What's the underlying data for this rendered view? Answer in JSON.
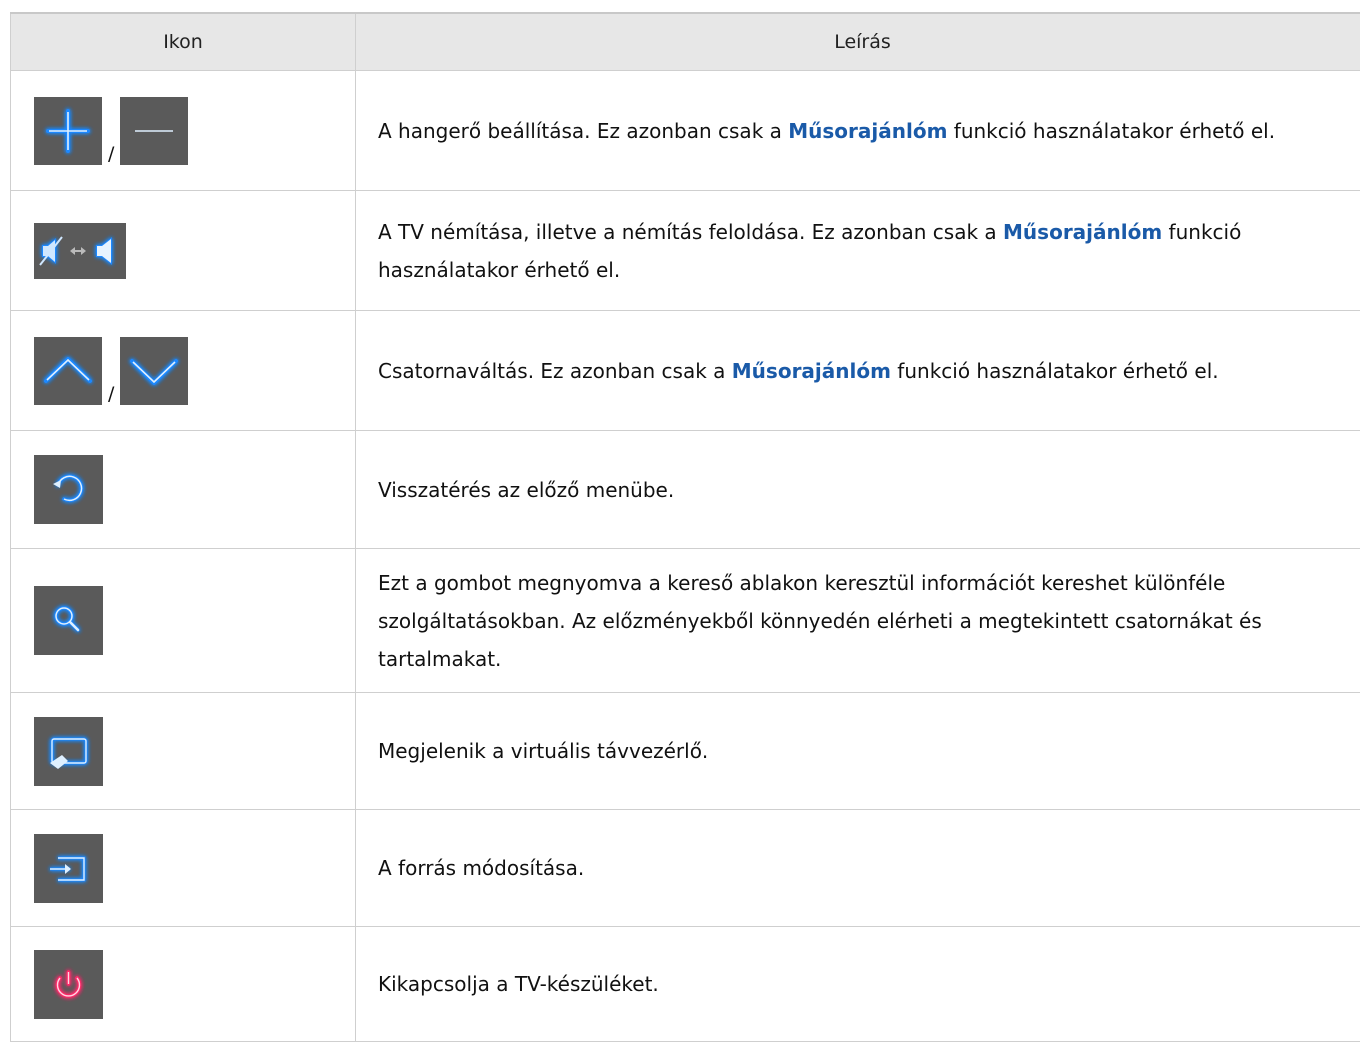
{
  "table": {
    "headers": [
      "Ikon",
      "Leírás"
    ],
    "separator": "/",
    "rows": [
      {
        "icons": [
          "plus-icon",
          "minus-icon"
        ],
        "text": [
          {
            "t": "A hangerő beállítása. Ez azonban csak a "
          },
          {
            "t": "Műsorajánlóm",
            "em": true
          },
          {
            "t": " funkció használatakor érhető el."
          }
        ]
      },
      {
        "icons": [
          "mute-toggle-icon"
        ],
        "text": [
          {
            "t": "A TV némítása, illetve a némítás feloldása. Ez azonban csak a "
          },
          {
            "t": "Műsorajánlóm",
            "em": true
          },
          {
            "t": " funkció használatakor érhető el."
          }
        ]
      },
      {
        "icons": [
          "chevron-up-icon",
          "chevron-down-icon"
        ],
        "text": [
          {
            "t": "Csatornaváltás. Ez azonban csak a "
          },
          {
            "t": "Műsorajánlóm",
            "em": true
          },
          {
            "t": " funkció használatakor érhető el."
          }
        ]
      },
      {
        "icons": [
          "return-icon"
        ],
        "text": [
          {
            "t": "Visszatérés az előző menübe."
          }
        ]
      },
      {
        "icons": [
          "search-icon"
        ],
        "text": [
          {
            "t": "Ezt a gombot megnyomva a kereső ablakon keresztül információt kereshet különféle szolgáltatásokban. Az előzményekből könnyedén elérheti a megtekintett csatornákat és tartalmakat."
          }
        ]
      },
      {
        "icons": [
          "virtual-remote-icon"
        ],
        "text": [
          {
            "t": "Megjelenik a virtuális távvezérlő."
          }
        ]
      },
      {
        "icons": [
          "source-icon"
        ],
        "text": [
          {
            "t": "A forrás módosítása."
          }
        ]
      },
      {
        "icons": [
          "power-icon"
        ],
        "text": [
          {
            "t": "Kikapcsolja a TV-készüléket."
          }
        ]
      }
    ]
  },
  "colors": {
    "accent_text": "#1a5aa8",
    "icon_bg": "#5a5a5a",
    "icon_glow": "#1e88ff",
    "power_glow": "#ff2a6a",
    "header_bg": "#e7e7e7",
    "border": "#cfcfcf"
  }
}
